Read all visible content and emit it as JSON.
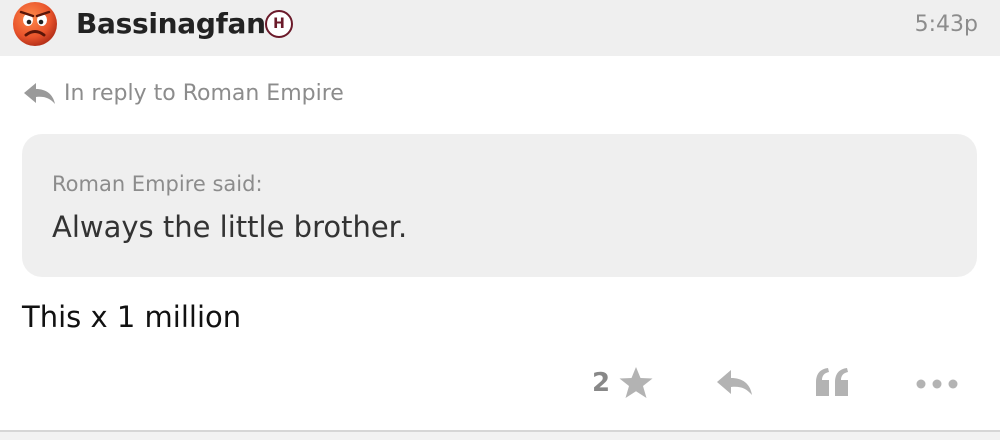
{
  "post": {
    "username": "Bassinagfan",
    "team_badge": "H",
    "timestamp": "5:43p",
    "avatar_icon": "angry-face-icon",
    "reply_context": "In reply to Roman Empire",
    "quote": {
      "author": "Roman Empire said:",
      "text": "Always the little brother."
    },
    "body": "This x 1 million",
    "actions": {
      "like_count": "2",
      "like_icon": "star-icon",
      "reply_icon": "reply-icon",
      "quote_icon": "quote-icon",
      "more_icon": "more-icon"
    }
  },
  "colors": {
    "header_bg": "#efefef",
    "quote_bg": "#efefef",
    "muted_text": "#8c8c8c",
    "badge": "#6b1a2a",
    "avatar": "#e8532b"
  }
}
